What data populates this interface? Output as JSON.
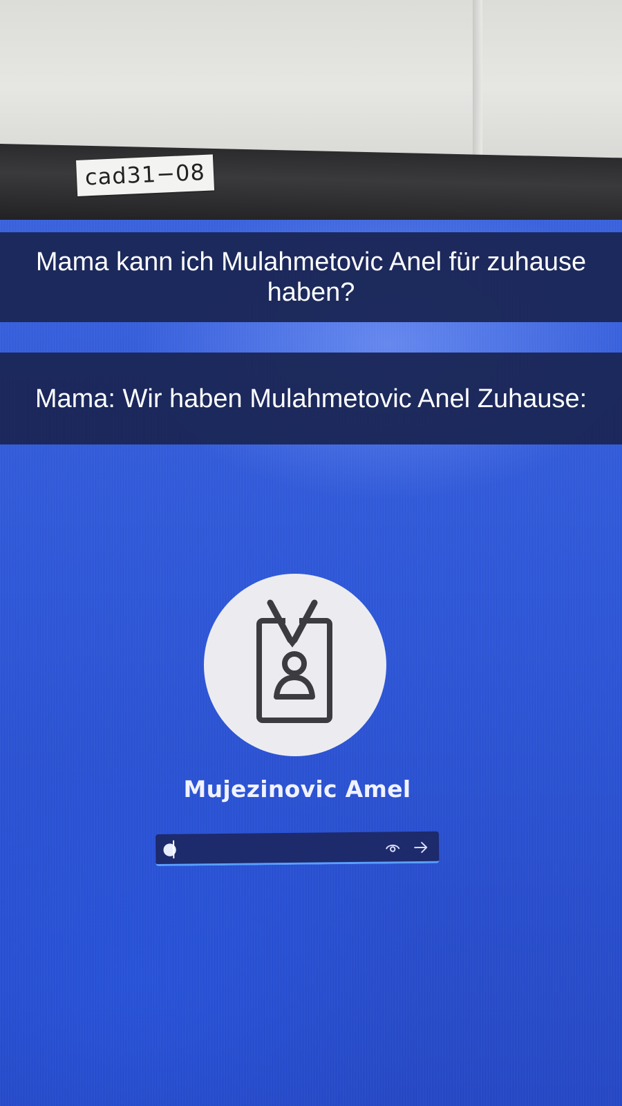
{
  "sticker": {
    "text": "cad31−08"
  },
  "captions": {
    "first": "Mama kann ich Mulahmetovic Anel für zuhause haben?",
    "second": "Mama: Wir haben Mulahmetovic Anel Zuhause:"
  },
  "login": {
    "avatar_icon": "id-badge-icon",
    "user_name": "Mujezinovic Amel",
    "password_value": "●",
    "reveal_icon": "eye-icon",
    "submit_icon": "arrow-right-icon"
  },
  "colors": {
    "screen_blue": "#2f58d8",
    "caption_bar": "#1b2756",
    "field_bg": "#1d2a6b",
    "field_accent": "#5aa0ff"
  }
}
